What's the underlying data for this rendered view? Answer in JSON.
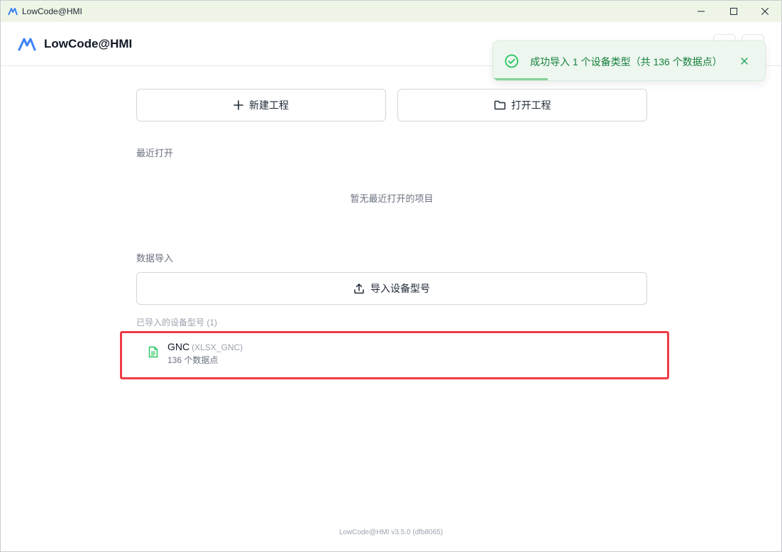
{
  "window": {
    "title": "LowCode@HMI"
  },
  "header": {
    "brand": "LowCode@HMI"
  },
  "toast": {
    "message": "成功导入 1 个设备类型（共 136 个数据点）",
    "progress": 0.2
  },
  "actions": {
    "new_project": "新建工程",
    "open_project": "打开工程"
  },
  "recent": {
    "label": "最近打开",
    "empty": "暂无最近打开的项目"
  },
  "data_import": {
    "label": "数据导入",
    "import_button": "导入设备型号",
    "imported_label": "已导入的设备型号 (1)",
    "devices": [
      {
        "name": "GNC",
        "type": "(XLSX_GNC)",
        "count": "136 个数据点"
      }
    ]
  },
  "footer": {
    "version": "LowCode@HMI v3.5.0 (dfb8065)"
  },
  "colors": {
    "accent": "#3b82f6",
    "success": "#22c55e",
    "highlight": "#ef3b45",
    "titlebar_bg": "#eef5e6"
  }
}
